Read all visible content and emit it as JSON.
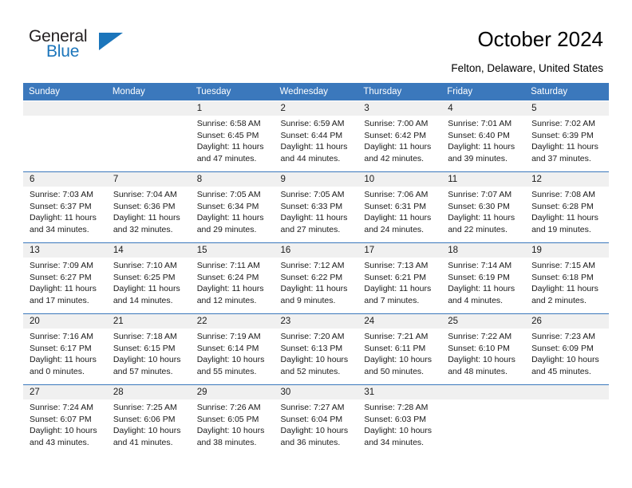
{
  "brand": {
    "name_part1": "General",
    "name_part2": "Blue",
    "triangle_color": "#1b75bb"
  },
  "header": {
    "title": "October 2024",
    "location": "Felton, Delaware, United States"
  },
  "theme": {
    "header_blue": "#3b78bc",
    "daynum_band": "#f0f0f0",
    "text": "#1a1a1a"
  },
  "weekday_headers": [
    "Sunday",
    "Monday",
    "Tuesday",
    "Wednesday",
    "Thursday",
    "Friday",
    "Saturday"
  ],
  "weeks": [
    [
      {
        "day": "",
        "empty": true,
        "sunrise": "",
        "sunset": "",
        "daylight1": "",
        "daylight2": ""
      },
      {
        "day": "",
        "empty": true,
        "sunrise": "",
        "sunset": "",
        "daylight1": "",
        "daylight2": ""
      },
      {
        "day": "1",
        "empty": false,
        "sunrise": "Sunrise: 6:58 AM",
        "sunset": "Sunset: 6:45 PM",
        "daylight1": "Daylight: 11 hours",
        "daylight2": "and 47 minutes."
      },
      {
        "day": "2",
        "empty": false,
        "sunrise": "Sunrise: 6:59 AM",
        "sunset": "Sunset: 6:44 PM",
        "daylight1": "Daylight: 11 hours",
        "daylight2": "and 44 minutes."
      },
      {
        "day": "3",
        "empty": false,
        "sunrise": "Sunrise: 7:00 AM",
        "sunset": "Sunset: 6:42 PM",
        "daylight1": "Daylight: 11 hours",
        "daylight2": "and 42 minutes."
      },
      {
        "day": "4",
        "empty": false,
        "sunrise": "Sunrise: 7:01 AM",
        "sunset": "Sunset: 6:40 PM",
        "daylight1": "Daylight: 11 hours",
        "daylight2": "and 39 minutes."
      },
      {
        "day": "5",
        "empty": false,
        "sunrise": "Sunrise: 7:02 AM",
        "sunset": "Sunset: 6:39 PM",
        "daylight1": "Daylight: 11 hours",
        "daylight2": "and 37 minutes."
      }
    ],
    [
      {
        "day": "6",
        "empty": false,
        "sunrise": "Sunrise: 7:03 AM",
        "sunset": "Sunset: 6:37 PM",
        "daylight1": "Daylight: 11 hours",
        "daylight2": "and 34 minutes."
      },
      {
        "day": "7",
        "empty": false,
        "sunrise": "Sunrise: 7:04 AM",
        "sunset": "Sunset: 6:36 PM",
        "daylight1": "Daylight: 11 hours",
        "daylight2": "and 32 minutes."
      },
      {
        "day": "8",
        "empty": false,
        "sunrise": "Sunrise: 7:05 AM",
        "sunset": "Sunset: 6:34 PM",
        "daylight1": "Daylight: 11 hours",
        "daylight2": "and 29 minutes."
      },
      {
        "day": "9",
        "empty": false,
        "sunrise": "Sunrise: 7:05 AM",
        "sunset": "Sunset: 6:33 PM",
        "daylight1": "Daylight: 11 hours",
        "daylight2": "and 27 minutes."
      },
      {
        "day": "10",
        "empty": false,
        "sunrise": "Sunrise: 7:06 AM",
        "sunset": "Sunset: 6:31 PM",
        "daylight1": "Daylight: 11 hours",
        "daylight2": "and 24 minutes."
      },
      {
        "day": "11",
        "empty": false,
        "sunrise": "Sunrise: 7:07 AM",
        "sunset": "Sunset: 6:30 PM",
        "daylight1": "Daylight: 11 hours",
        "daylight2": "and 22 minutes."
      },
      {
        "day": "12",
        "empty": false,
        "sunrise": "Sunrise: 7:08 AM",
        "sunset": "Sunset: 6:28 PM",
        "daylight1": "Daylight: 11 hours",
        "daylight2": "and 19 minutes."
      }
    ],
    [
      {
        "day": "13",
        "empty": false,
        "sunrise": "Sunrise: 7:09 AM",
        "sunset": "Sunset: 6:27 PM",
        "daylight1": "Daylight: 11 hours",
        "daylight2": "and 17 minutes."
      },
      {
        "day": "14",
        "empty": false,
        "sunrise": "Sunrise: 7:10 AM",
        "sunset": "Sunset: 6:25 PM",
        "daylight1": "Daylight: 11 hours",
        "daylight2": "and 14 minutes."
      },
      {
        "day": "15",
        "empty": false,
        "sunrise": "Sunrise: 7:11 AM",
        "sunset": "Sunset: 6:24 PM",
        "daylight1": "Daylight: 11 hours",
        "daylight2": "and 12 minutes."
      },
      {
        "day": "16",
        "empty": false,
        "sunrise": "Sunrise: 7:12 AM",
        "sunset": "Sunset: 6:22 PM",
        "daylight1": "Daylight: 11 hours",
        "daylight2": "and 9 minutes."
      },
      {
        "day": "17",
        "empty": false,
        "sunrise": "Sunrise: 7:13 AM",
        "sunset": "Sunset: 6:21 PM",
        "daylight1": "Daylight: 11 hours",
        "daylight2": "and 7 minutes."
      },
      {
        "day": "18",
        "empty": false,
        "sunrise": "Sunrise: 7:14 AM",
        "sunset": "Sunset: 6:19 PM",
        "daylight1": "Daylight: 11 hours",
        "daylight2": "and 4 minutes."
      },
      {
        "day": "19",
        "empty": false,
        "sunrise": "Sunrise: 7:15 AM",
        "sunset": "Sunset: 6:18 PM",
        "daylight1": "Daylight: 11 hours",
        "daylight2": "and 2 minutes."
      }
    ],
    [
      {
        "day": "20",
        "empty": false,
        "sunrise": "Sunrise: 7:16 AM",
        "sunset": "Sunset: 6:17 PM",
        "daylight1": "Daylight: 11 hours",
        "daylight2": "and 0 minutes."
      },
      {
        "day": "21",
        "empty": false,
        "sunrise": "Sunrise: 7:18 AM",
        "sunset": "Sunset: 6:15 PM",
        "daylight1": "Daylight: 10 hours",
        "daylight2": "and 57 minutes."
      },
      {
        "day": "22",
        "empty": false,
        "sunrise": "Sunrise: 7:19 AM",
        "sunset": "Sunset: 6:14 PM",
        "daylight1": "Daylight: 10 hours",
        "daylight2": "and 55 minutes."
      },
      {
        "day": "23",
        "empty": false,
        "sunrise": "Sunrise: 7:20 AM",
        "sunset": "Sunset: 6:13 PM",
        "daylight1": "Daylight: 10 hours",
        "daylight2": "and 52 minutes."
      },
      {
        "day": "24",
        "empty": false,
        "sunrise": "Sunrise: 7:21 AM",
        "sunset": "Sunset: 6:11 PM",
        "daylight1": "Daylight: 10 hours",
        "daylight2": "and 50 minutes."
      },
      {
        "day": "25",
        "empty": false,
        "sunrise": "Sunrise: 7:22 AM",
        "sunset": "Sunset: 6:10 PM",
        "daylight1": "Daylight: 10 hours",
        "daylight2": "and 48 minutes."
      },
      {
        "day": "26",
        "empty": false,
        "sunrise": "Sunrise: 7:23 AM",
        "sunset": "Sunset: 6:09 PM",
        "daylight1": "Daylight: 10 hours",
        "daylight2": "and 45 minutes."
      }
    ],
    [
      {
        "day": "27",
        "empty": false,
        "sunrise": "Sunrise: 7:24 AM",
        "sunset": "Sunset: 6:07 PM",
        "daylight1": "Daylight: 10 hours",
        "daylight2": "and 43 minutes."
      },
      {
        "day": "28",
        "empty": false,
        "sunrise": "Sunrise: 7:25 AM",
        "sunset": "Sunset: 6:06 PM",
        "daylight1": "Daylight: 10 hours",
        "daylight2": "and 41 minutes."
      },
      {
        "day": "29",
        "empty": false,
        "sunrise": "Sunrise: 7:26 AM",
        "sunset": "Sunset: 6:05 PM",
        "daylight1": "Daylight: 10 hours",
        "daylight2": "and 38 minutes."
      },
      {
        "day": "30",
        "empty": false,
        "sunrise": "Sunrise: 7:27 AM",
        "sunset": "Sunset: 6:04 PM",
        "daylight1": "Daylight: 10 hours",
        "daylight2": "and 36 minutes."
      },
      {
        "day": "31",
        "empty": false,
        "sunrise": "Sunrise: 7:28 AM",
        "sunset": "Sunset: 6:03 PM",
        "daylight1": "Daylight: 10 hours",
        "daylight2": "and 34 minutes."
      },
      {
        "day": "",
        "empty": true,
        "sunrise": "",
        "sunset": "",
        "daylight1": "",
        "daylight2": ""
      },
      {
        "day": "",
        "empty": true,
        "sunrise": "",
        "sunset": "",
        "daylight1": "",
        "daylight2": ""
      }
    ]
  ]
}
